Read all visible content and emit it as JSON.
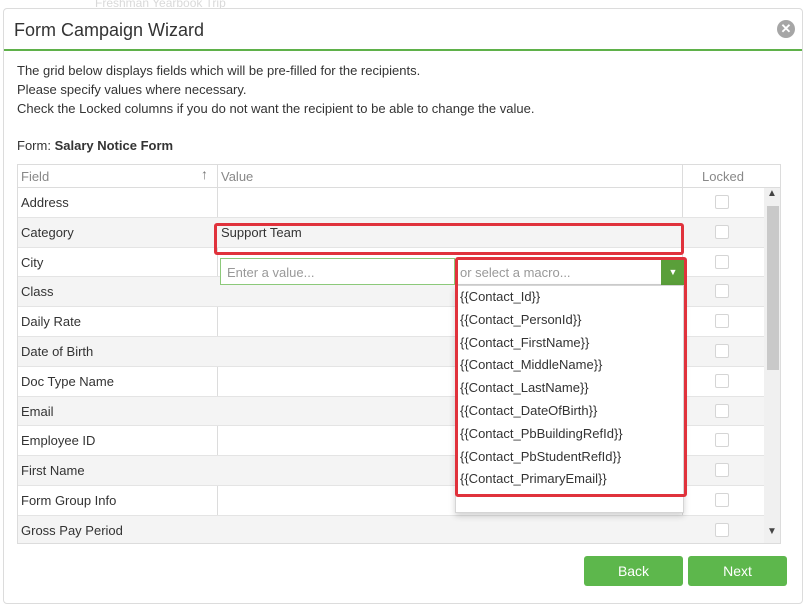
{
  "background": {
    "faint_text": "Freshman Yearbook Trip"
  },
  "dialog": {
    "title": "Form Campaign Wizard",
    "close_icon": "close-icon",
    "instructions": [
      "The grid below displays fields which will be pre-filled for the recipients.",
      "Please specify values where necessary.",
      "Check the Locked columns if you do not want the recipient to be able to change the value."
    ],
    "form_label": "Form:",
    "form_name": "Salary Notice Form"
  },
  "grid": {
    "headers": {
      "field": "Field",
      "value": "Value",
      "locked": "Locked"
    },
    "sort_icon": "sort-up-arrow-icon",
    "rows": [
      {
        "field": "Address",
        "value": ""
      },
      {
        "field": "Category",
        "value": "Support Team"
      },
      {
        "field": "City",
        "value": ""
      },
      {
        "field": "Class",
        "value": ""
      },
      {
        "field": "Daily Rate",
        "value": ""
      },
      {
        "field": "Date of Birth",
        "value": ""
      },
      {
        "field": "Doc Type Name",
        "value": ""
      },
      {
        "field": "Email",
        "value": ""
      },
      {
        "field": "Employee ID",
        "value": ""
      },
      {
        "field": "First Name",
        "value": ""
      },
      {
        "field": "Form Group Info",
        "value": ""
      },
      {
        "field": "Gross Pay Period",
        "value": ""
      }
    ],
    "editor": {
      "value_placeholder": "Enter a value...",
      "macro_placeholder": "or select a macro..."
    },
    "macros": [
      "{{Contact_Id}}",
      "{{Contact_PersonId}}",
      "{{Contact_FirstName}}",
      "{{Contact_MiddleName}}",
      "{{Contact_LastName}}",
      "{{Contact_DateOfBirth}}",
      "{{Contact_PbBuildingRefId}}",
      "{{Contact_PbStudentRefId}}",
      "{{Contact_PrimaryEmail}}"
    ]
  },
  "footer": {
    "back_label": "Back",
    "next_label": "Next"
  },
  "colors": {
    "accent": "#5db74c",
    "highlight": "#e0323c"
  }
}
